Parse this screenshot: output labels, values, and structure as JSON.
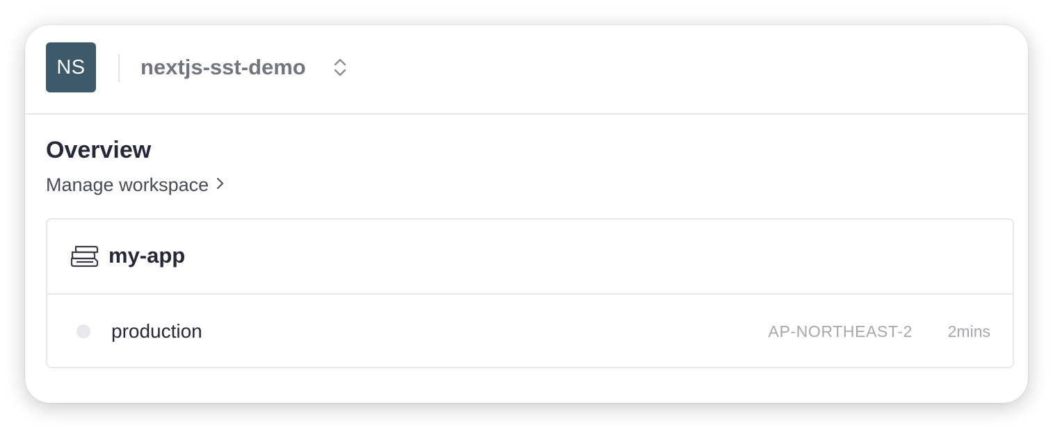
{
  "workspace": {
    "initials": "NS",
    "name": "nextjs-sst-demo",
    "avatar_color": "#3e5a6a",
    "switcher_icon": "chevron-up-down-icon"
  },
  "page": {
    "title": "Overview",
    "manage_link": "Manage workspace",
    "manage_icon": "chevron-right-icon"
  },
  "app": {
    "icon": "app-stack-icon",
    "name": "my-app",
    "stages": [
      {
        "name": "production",
        "region": "AP-NORTHEAST-2",
        "updated": "2mins",
        "status_color": "#e8e8ec"
      }
    ]
  }
}
